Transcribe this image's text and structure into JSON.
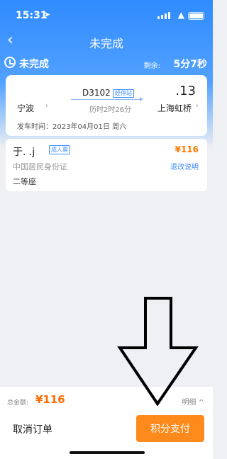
{
  "status_bar": {
    "time": "15:31",
    "location": "➤",
    "wifi": "▲"
  },
  "nav": {
    "back_icon": "‹",
    "title": "未完成"
  },
  "order_status": {
    "label": "未完成",
    "remaining_label": "剩余:",
    "remaining": "5分7秒"
  },
  "trip": {
    "train_no": "D3102",
    "via_label": "经停站",
    "duration": "历时2时26分",
    "from_station": "宁波",
    "to_station": "上海虹桥",
    "arrival_time_partial": ".13",
    "chevron": "›",
    "departure_time": "发车时间：2023年04月01日 周六"
  },
  "passenger": {
    "name": "于.  .j",
    "ticket_type": "成人票",
    "price": "¥116",
    "id_type": "中国居民身份证",
    "refund_link": "退改说明",
    "seat": "二等座"
  },
  "footer": {
    "total_label": "总金额:",
    "total": "¥116",
    "detail_label": "明细 ^",
    "cancel_label": "取消订单",
    "pay_label": "积分支付"
  },
  "colors": {
    "primary": "#2f8bff",
    "accent": "#ff8a1c",
    "link": "#3b8cff"
  }
}
